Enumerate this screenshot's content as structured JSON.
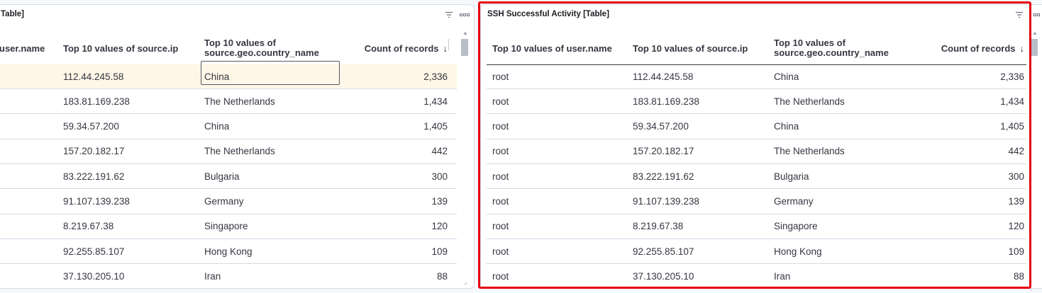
{
  "left_panel": {
    "title": "Table]",
    "headers": {
      "user": "user.name",
      "ip": "Top 10 values of source.ip",
      "country_line1": "Top 10 values of",
      "country_line2": "source.geo.country_name",
      "count": "Count of records",
      "sort_icon": "↓"
    },
    "focused_cell": "China",
    "rows": [
      {
        "ip": "112.44.245.58",
        "country": "China",
        "count": "2,336"
      },
      {
        "ip": "183.81.169.238",
        "country": "The Netherlands",
        "count": "1,434"
      },
      {
        "ip": "59.34.57.200",
        "country": "China",
        "count": "1,405"
      },
      {
        "ip": "157.20.182.17",
        "country": "The Netherlands",
        "count": "442"
      },
      {
        "ip": "83.222.191.62",
        "country": "Bulgaria",
        "count": "300"
      },
      {
        "ip": "91.107.139.238",
        "country": "Germany",
        "count": "139"
      },
      {
        "ip": "8.219.67.38",
        "country": "Singapore",
        "count": "120"
      },
      {
        "ip": "92.255.85.107",
        "country": "Hong Kong",
        "count": "109"
      },
      {
        "ip": "37.130.205.10",
        "country": "Iran",
        "count": "88"
      }
    ]
  },
  "right_panel": {
    "title": "SSH Successful Activity [Table]",
    "headers": {
      "user": "Top 10 values of user.name",
      "ip": "Top 10 values of source.ip",
      "country_line1": "Top 10 values of",
      "country_line2": "source.geo.country_name",
      "count": "Count of records",
      "sort_icon": "↓"
    },
    "rows": [
      {
        "user": "root",
        "ip": "112.44.245.58",
        "country": "China",
        "count": "2,336"
      },
      {
        "user": "root",
        "ip": "183.81.169.238",
        "country": "The Netherlands",
        "count": "1,434"
      },
      {
        "user": "root",
        "ip": "59.34.57.200",
        "country": "China",
        "count": "1,405"
      },
      {
        "user": "root",
        "ip": "157.20.182.17",
        "country": "The Netherlands",
        "count": "442"
      },
      {
        "user": "root",
        "ip": "83.222.191.62",
        "country": "Bulgaria",
        "count": "300"
      },
      {
        "user": "root",
        "ip": "91.107.139.238",
        "country": "Germany",
        "count": "139"
      },
      {
        "user": "root",
        "ip": "8.219.67.38",
        "country": "Singapore",
        "count": "120"
      },
      {
        "user": "root",
        "ip": "92.255.85.107",
        "country": "Hong Kong",
        "count": "109"
      },
      {
        "user": "root",
        "ip": "37.130.205.10",
        "country": "Iran",
        "count": "88"
      }
    ]
  },
  "icons": {
    "filter": "filter-icon",
    "options": "options-menu-icon",
    "resize": "resize-handle-icon"
  },
  "colors": {
    "highlight_outline": "#e4000f",
    "row_highlight": "#fef6e6",
    "border": "#d3dae6",
    "text": "#343741"
  }
}
